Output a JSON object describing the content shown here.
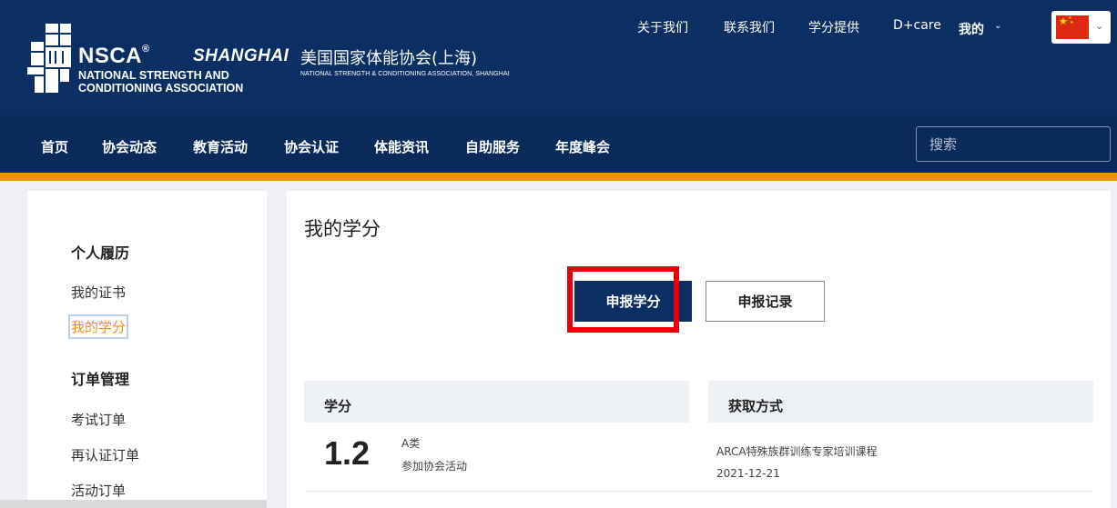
{
  "header": {
    "logo": {
      "nsca": "NSCA",
      "registered": "®",
      "shanghai": "SHANGHAI",
      "sub_line1": "NATIONAL STRENGTH AND",
      "sub_line2": "CONDITIONING ASSOCIATION",
      "cn_name": "美国国家体能协会(上海)",
      "en_full": "NATIONAL STRENGTH & CONDITIONING ASSOCIATION, SHANGHAI"
    },
    "top_links": [
      "关于我们",
      "联系我们",
      "学分提供",
      "D+care"
    ],
    "account_label": "我的",
    "language_flag": "china-flag-icon"
  },
  "nav": {
    "items": [
      "首页",
      "协会动态",
      "教育活动",
      "协会认证",
      "体能资讯",
      "自助服务",
      "年度峰会"
    ],
    "search_placeholder": "搜索"
  },
  "sidebar": {
    "groups": [
      {
        "heading": "个人履历",
        "items": [
          "我的证书",
          "我的学分"
        ]
      },
      {
        "heading": "订单管理",
        "items": [
          "考试订单",
          "再认证订单",
          "活动订单"
        ]
      }
    ],
    "active_item": "我的学分"
  },
  "main": {
    "title": "我的学分",
    "buttons": {
      "apply": "申报学分",
      "records": "申报记录"
    },
    "highlight_color": "#e8000b",
    "table": {
      "headers": [
        "学分",
        "获取方式"
      ],
      "rows": [
        {
          "credit": "1.2",
          "category": "A类",
          "activity": "参加协会活动",
          "method": "ARCA特殊族群训练专家培训课程",
          "date": "2021-12-21"
        }
      ]
    }
  },
  "colors": {
    "header_bg": "#0c2f63",
    "nav_bg": "#0a2a59",
    "accent_orange": "#f0900f",
    "active_link": "#f0900f"
  }
}
